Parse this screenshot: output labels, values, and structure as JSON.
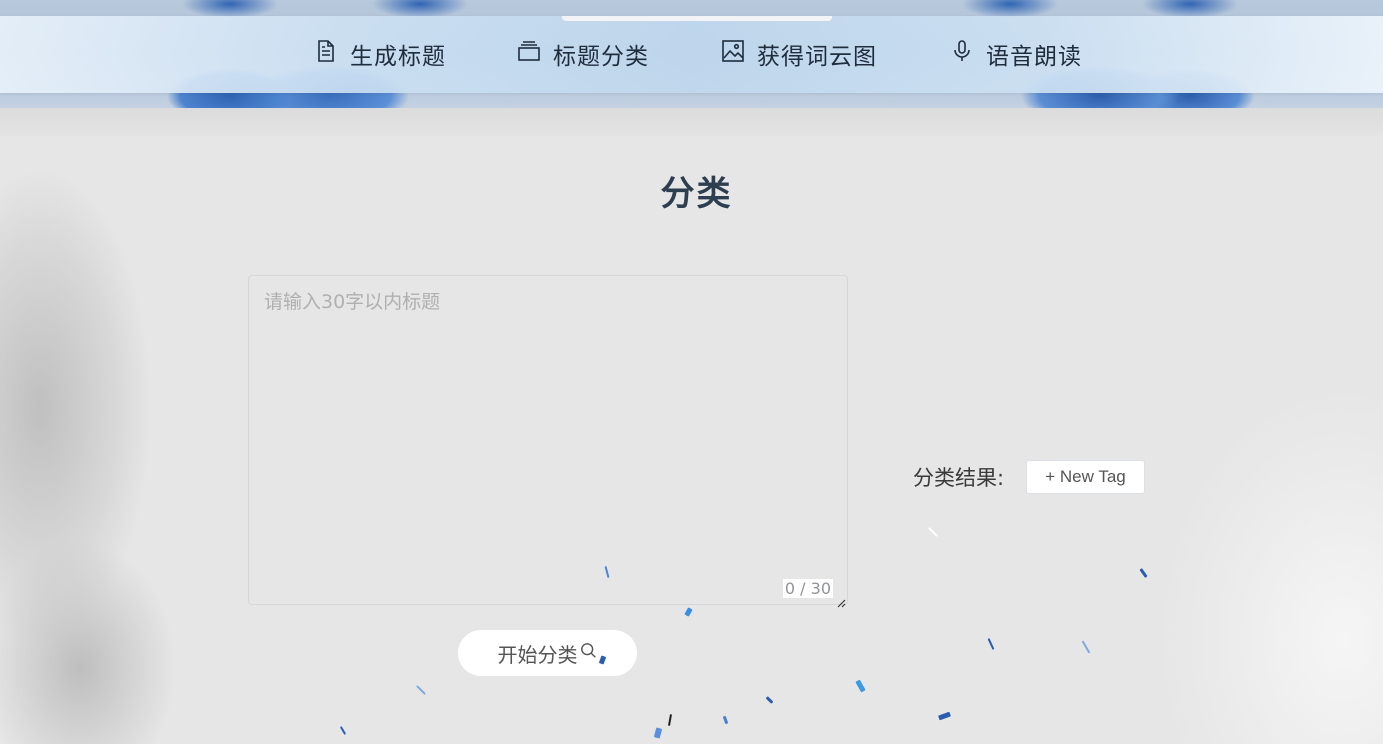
{
  "nav": {
    "items": [
      {
        "label": "生成标题",
        "icon": "document-icon"
      },
      {
        "label": "标题分类",
        "icon": "stack-icon"
      },
      {
        "label": "获得词云图",
        "icon": "picture-icon"
      },
      {
        "label": "语音朗读",
        "icon": "microphone-icon"
      }
    ]
  },
  "main": {
    "title": "分类",
    "input": {
      "placeholder": "请输入30字以内标题",
      "value": "",
      "counter": "0 / 30"
    },
    "start_button": {
      "label": "开始分类",
      "icon": "magnifier-icon"
    },
    "result": {
      "label": "分类结果:",
      "new_tag_label": "+ New Tag"
    }
  },
  "colors": {
    "title": "#2c3e50",
    "background": "#e6e6e6",
    "confetti": "#3a7bd5"
  }
}
